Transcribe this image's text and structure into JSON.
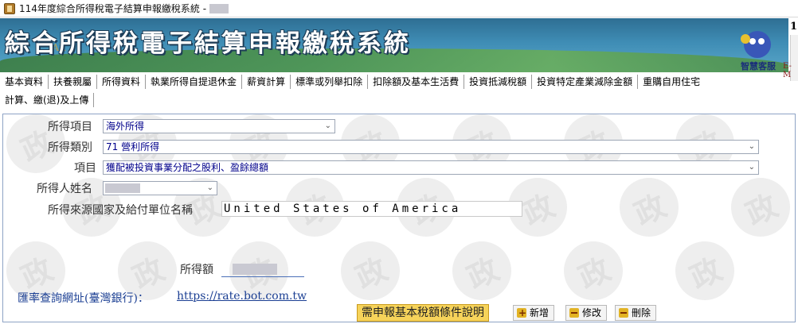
{
  "window": {
    "title": "114年度綜合所得稅電子結算申報繳稅系統 -"
  },
  "banner": {
    "title": "綜合所得稅電子結算申報繳稅系統",
    "tax_text": "TAX",
    "assistant_label": "智慧客服",
    "edge_number": "1",
    "edge_text": "E-M"
  },
  "menu": {
    "row1": [
      "基本資料",
      "扶養親屬",
      "所得資料",
      "執業所得自提退休金",
      "薪資計算",
      "標準或列舉扣除",
      "扣除額及基本生活費",
      "投資抵減稅額",
      "投資特定產業減除金額",
      "重購自用住宅"
    ],
    "row2": [
      "計算、繳(退)及上傳"
    ]
  },
  "form": {
    "income_item_label": "所得項目",
    "income_item_value": "海外所得",
    "income_category_label": "所得類別",
    "income_category_value": "71 營利所得",
    "item_label": "項目",
    "item_value": "獲配被投資事業分配之股利、盈餘總額",
    "earner_name_label": "所得人姓名",
    "source_label": "所得來源國家及給付單位名稱",
    "source_value": "United States of America",
    "amount_label": "所得額"
  },
  "footer": {
    "rate_text": "匯率查詢網址(臺灣銀行)：",
    "rate_link": "https://rate.bot.com.tw",
    "note_button": "需申報基本稅額條件說明",
    "add_button": "新增",
    "edit_button": "修改",
    "delete_button": "刪除"
  },
  "watermark_glyph": "政",
  "colors": {
    "banner": "#3f8db5",
    "link": "#1b3f93",
    "note_button": "#f6d35a",
    "field_text": "#00008b"
  }
}
